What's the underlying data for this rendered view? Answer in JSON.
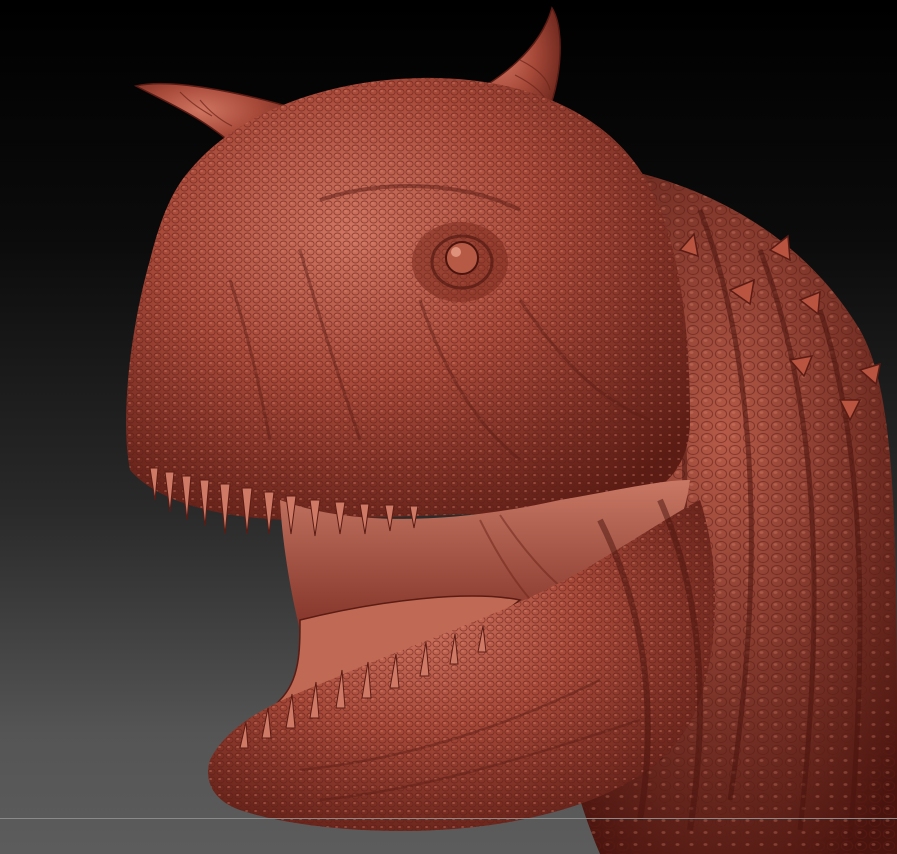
{
  "scene": {
    "subject": "carnotaurus-head-sculpt",
    "background_colors": [
      "#000000",
      "#2a2a2a",
      "#5c5c5c"
    ],
    "clay_color": "#a84a3a",
    "clay_shadow_color": "#5a1c14",
    "clay_highlight_color": "#d9826c"
  }
}
